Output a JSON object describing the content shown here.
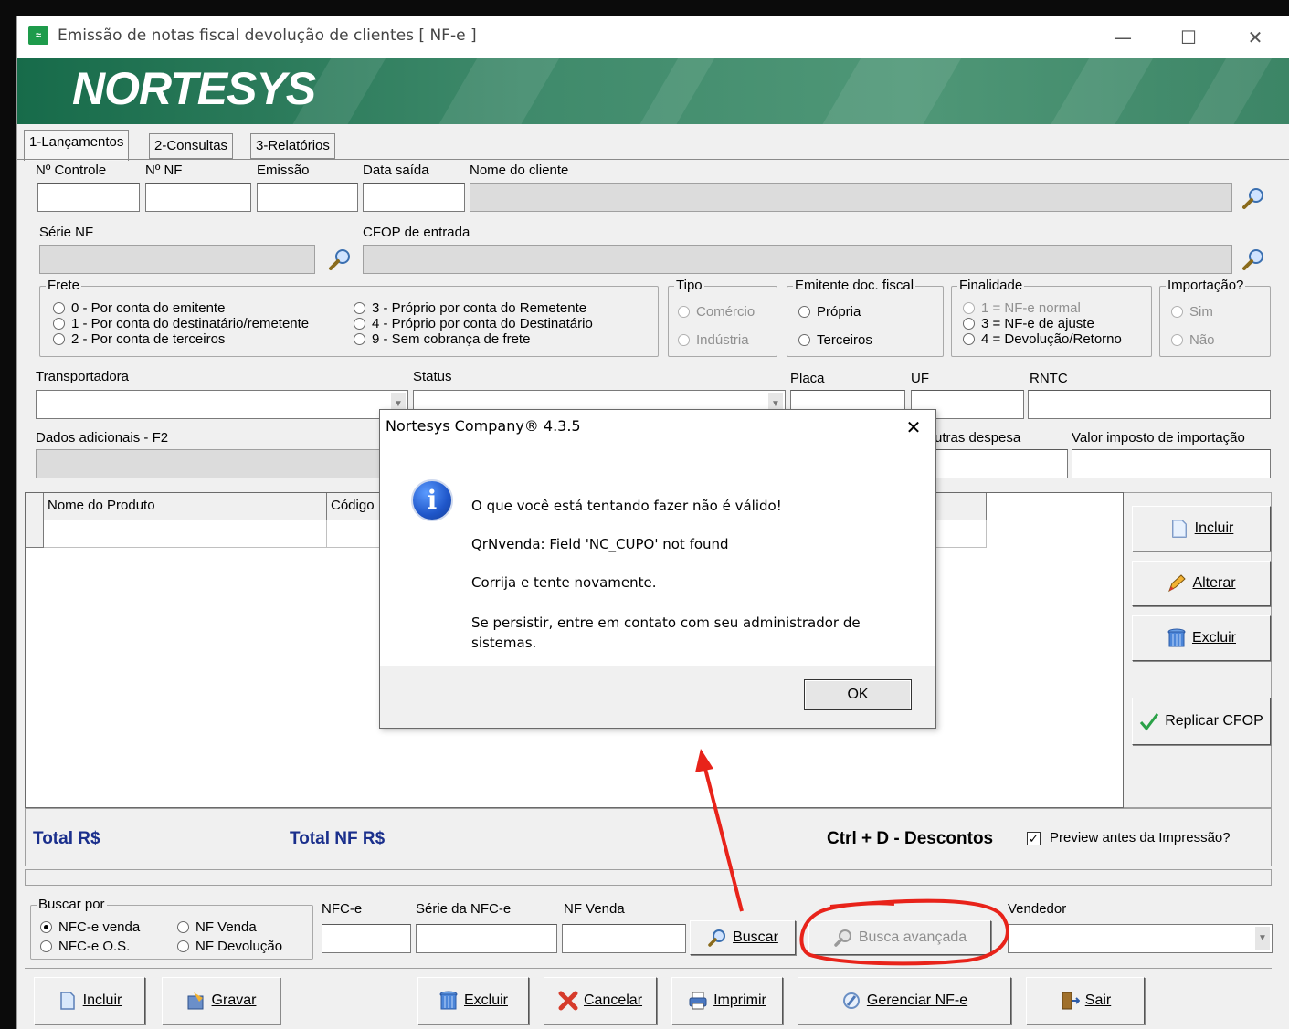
{
  "window": {
    "title": "Emissão de notas fiscal devolução de clientes [ NF-e ]",
    "minimize": "—",
    "maximize": "☐",
    "close": "✕"
  },
  "banner": {
    "brand": "NORTESYS"
  },
  "tabs": [
    {
      "label": "1-Lançamentos",
      "active": true
    },
    {
      "label": "2-Consultas"
    },
    {
      "label": "3-Relatórios"
    }
  ],
  "header": {
    "n_controle": "Nº Controle",
    "n_nf": "Nº NF",
    "emissao": "Emissão",
    "data_saida": "Data saída",
    "nome_cliente": "Nome do cliente",
    "serie_nf": "Série NF",
    "cfop_entrada": "CFOP de entrada"
  },
  "frete": {
    "title": "Frete",
    "options": [
      "0 - Por conta do emitente",
      "1 - Por conta do destinatário/remetente",
      "2 - Por conta de terceiros",
      "3 - Próprio por conta do Remetente",
      "4 - Próprio por conta do Destinatário",
      "9 - Sem cobrança de frete"
    ]
  },
  "tipo": {
    "title": "Tipo",
    "options": [
      "Comércio",
      "Indústria"
    ]
  },
  "emitente": {
    "title": "Emitente doc. fiscal",
    "options": [
      "Própria",
      "Terceiros"
    ]
  },
  "finalidade": {
    "title": "Finalidade",
    "options": [
      "1 = NF-e normal",
      "3 = NF-e de ajuste",
      "4 = Devolução/Retorno"
    ]
  },
  "importacao": {
    "title": "Importação?",
    "options": [
      "Sim",
      "Não"
    ]
  },
  "row3": {
    "transportadora": "Transportadora",
    "status": "Status",
    "placa": "Placa",
    "uf": "UF",
    "rntc": "RNTC"
  },
  "row4": {
    "dados_adicionais": "Dados adicionais - F2",
    "outras_despesa": "utras despesa",
    "valor_imposto": "Valor imposto de importação"
  },
  "grid": {
    "columns": [
      "Nome do Produto",
      "Código"
    ]
  },
  "side_buttons": [
    "Incluir",
    "Alterar",
    "Excluir",
    "Replicar CFOP"
  ],
  "totals": {
    "total": "Total R$",
    "total_nf": "Total NF R$",
    "hint": "Ctrl + D - Descontos",
    "preview_label": "Preview antes da Impressão?",
    "preview_checked": "✓"
  },
  "search": {
    "title": "Buscar por",
    "options": [
      "NFC-e venda",
      "NF Venda",
      "NFC-e O.S.",
      "NF Devolução"
    ],
    "nfce": "NFC-e",
    "serie_nfce": "Série da NFC-e",
    "nf_venda": "NF Venda",
    "buscar": "Buscar",
    "busca_avancada": "Busca avançada",
    "vendedor": "Vendedor"
  },
  "bottom_buttons": [
    "Incluir",
    "Gravar",
    "Excluir",
    "Cancelar",
    "Imprimir",
    "Gerenciar NF-e",
    "Sair"
  ],
  "dialog": {
    "title": "Nortesys Company® 4.3.5",
    "close": "✕",
    "icon": "i",
    "line1": "O que você está tentando fazer não é válido!",
    "line2": "QrNvenda: Field 'NC_CUPO' not found",
    "line3": "Corrija e tente novamente.",
    "line4": "Se persistir, entre em contato com seu administrador de sistemas.",
    "ok": "OK"
  },
  "colors": {
    "annotation": "#e8231a",
    "banner": "#2e7d5b",
    "totals_text": "#1a2f8c"
  }
}
